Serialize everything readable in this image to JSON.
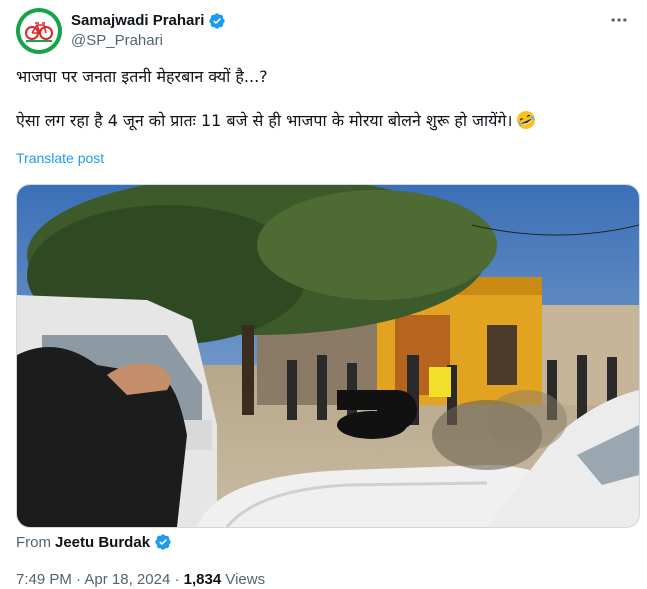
{
  "author": {
    "display_name": "Samajwadi Prahari",
    "handle": "@SP_Prahari",
    "verified": true
  },
  "tweet": {
    "line1": "भाजपा पर जनता इतनी मेहरबान क्यों है...?",
    "line2": "ऐसा लग रहा है 4 जून को प्रातः 11 बजे से ही भाजपा के मोरया बोलने शुरू हो जायेंगे।",
    "emoji": "rolling-on-floor-laughing"
  },
  "translate_label": "Translate post",
  "from": {
    "label": "From",
    "name": "Jeetu Burdak",
    "verified": true
  },
  "meta": {
    "time": "7:49 PM",
    "separator": " · ",
    "date": "Apr 18, 2024",
    "views_count": "1,834",
    "views_label": " Views"
  },
  "colors": {
    "link": "#1d9bf0",
    "secondary_text": "#536471",
    "primary_text": "#0f1419",
    "avatar_green": "#16a34a",
    "avatar_red": "#dc2626"
  },
  "icons": [
    "more-icon",
    "verified-badge-icon",
    "cycle-logo-icon"
  ]
}
